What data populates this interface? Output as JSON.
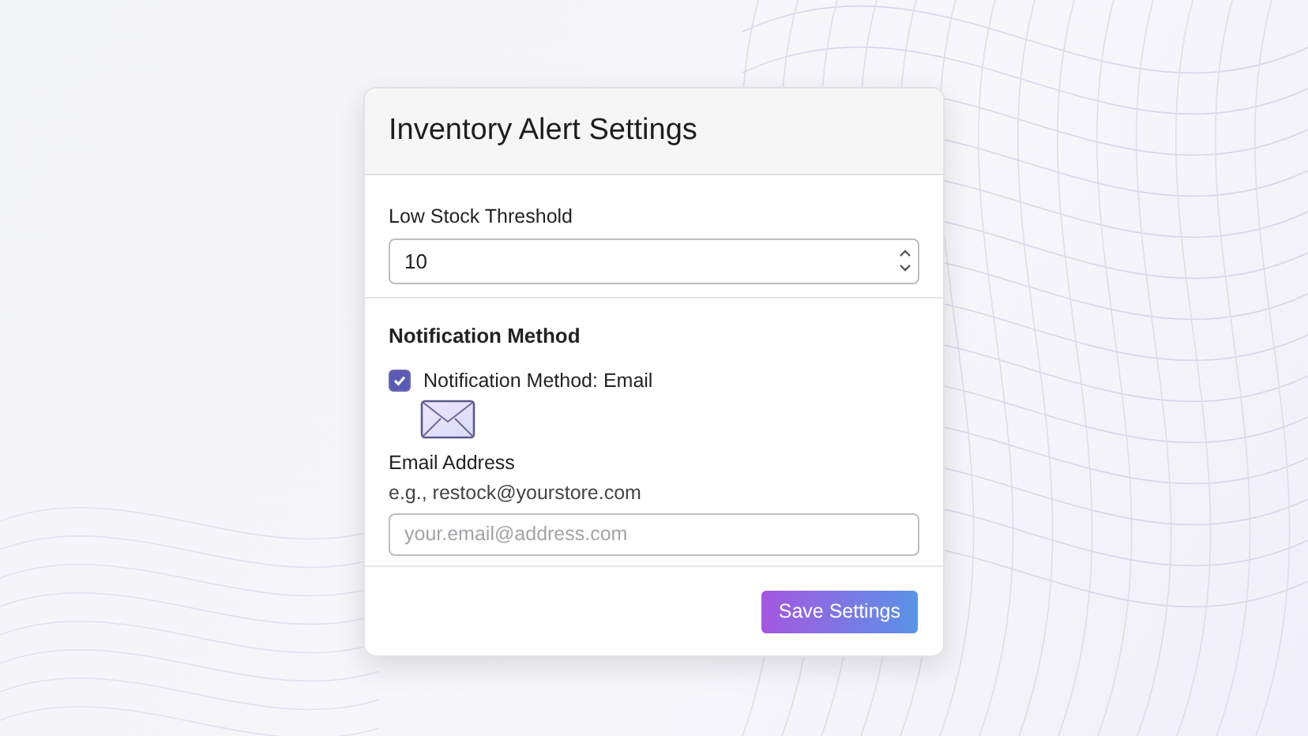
{
  "card": {
    "title": "Inventory Alert Settings"
  },
  "threshold": {
    "label": "Low Stock Threshold",
    "value": "10"
  },
  "notification": {
    "heading": "Notification Method",
    "checkbox_label": "Notification Method: Email",
    "checked": true
  },
  "email": {
    "label": "Email Address",
    "hint": "e.g., restock@yourstore.com",
    "placeholder": "your.email@address.com"
  },
  "buttons": [
    {
      "label": "Save Settings"
    }
  ]
}
